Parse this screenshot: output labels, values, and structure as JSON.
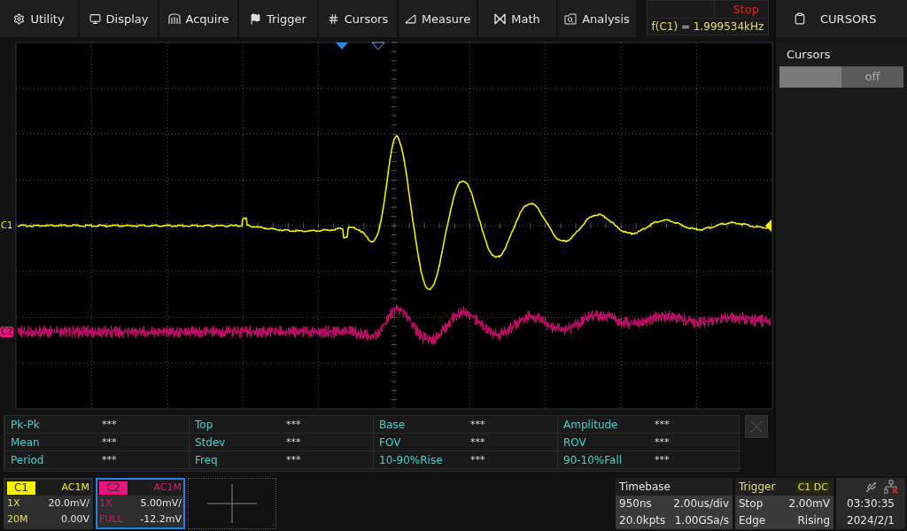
{
  "menu": [
    {
      "label": "Utility"
    },
    {
      "label": "Display"
    },
    {
      "label": "Acquire"
    },
    {
      "label": "Trigger"
    },
    {
      "label": "Cursors"
    },
    {
      "label": "Measure"
    },
    {
      "label": "Math"
    },
    {
      "label": "Analysis"
    }
  ],
  "status": {
    "state": "Stop",
    "frequency": "f(C1) = 1.999534kHz"
  },
  "side_panel": {
    "title": "CURSORS",
    "section": "Cursors",
    "toggle": {
      "label": "off",
      "on": false
    }
  },
  "traces": [
    {
      "label": "C1",
      "color": "#f4f000"
    },
    {
      "label": "C2",
      "color": "#e8137d"
    }
  ],
  "measurements": [
    [
      {
        "name": "Pk-Pk",
        "value": "***"
      },
      {
        "name": "Top",
        "value": "***"
      },
      {
        "name": "Base",
        "value": "***"
      },
      {
        "name": "Amplitude",
        "value": "***"
      }
    ],
    [
      {
        "name": "Mean",
        "value": "***"
      },
      {
        "name": "Stdev",
        "value": "***"
      },
      {
        "name": "FOV",
        "value": "***"
      },
      {
        "name": "ROV",
        "value": "***"
      }
    ],
    [
      {
        "name": "Period",
        "value": "***"
      },
      {
        "name": "Freq",
        "value": "***"
      },
      {
        "name": "10-90%Rise",
        "value": "***"
      },
      {
        "name": "90-10%Fall",
        "value": "***"
      }
    ]
  ],
  "channels": [
    {
      "label": "C1",
      "coupling": "AC1M",
      "probe": "1X",
      "scale": "20.0mV/",
      "bandwidth": "20M",
      "offset": "0.00V",
      "selected": false,
      "color": "#f4f000"
    },
    {
      "label": "C2",
      "coupling": "AC1M",
      "probe": "1X",
      "scale": "5.00mV/",
      "bandwidth": "FULL",
      "offset": "-12.2mV",
      "selected": true,
      "color": "#e8137d"
    }
  ],
  "timebase": {
    "title": "Timebase",
    "delay": "950ns",
    "scale": "2.00us/div",
    "points": "20.0kpts",
    "rate": "1.00GSa/s"
  },
  "trigger": {
    "title": "Trigger",
    "source": "C1 DC",
    "state": "Stop",
    "level": "2.00mV",
    "type": "Edge",
    "slope": "Rising"
  },
  "clock": {
    "time": "03:30:35",
    "date": "2024/2/1"
  }
}
